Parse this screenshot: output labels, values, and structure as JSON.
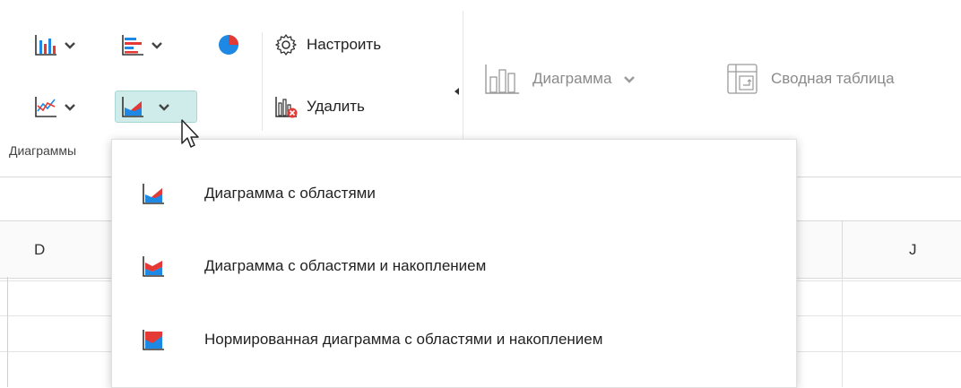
{
  "ribbon": {
    "configure_label": "Настроить",
    "delete_label": "Удалить",
    "group_label": "Диаграммы",
    "chart_label": "Диаграмма",
    "pivot_label": "Сводная таблица"
  },
  "columns": {
    "left": "D",
    "right": "J"
  },
  "dropdown": {
    "items": [
      {
        "label": "Диаграмма с областями",
        "icon": "area-chart-icon"
      },
      {
        "label": "Диаграмма с областями и накоплением",
        "icon": "stacked-area-chart-icon"
      },
      {
        "label": "Нормированная диаграмма с областями и накоплением",
        "icon": "percent-stacked-area-chart-icon"
      }
    ]
  },
  "colors": {
    "accent_blue": "#1e88e5",
    "accent_red": "#e53935",
    "active_bg": "#cfeceb"
  }
}
